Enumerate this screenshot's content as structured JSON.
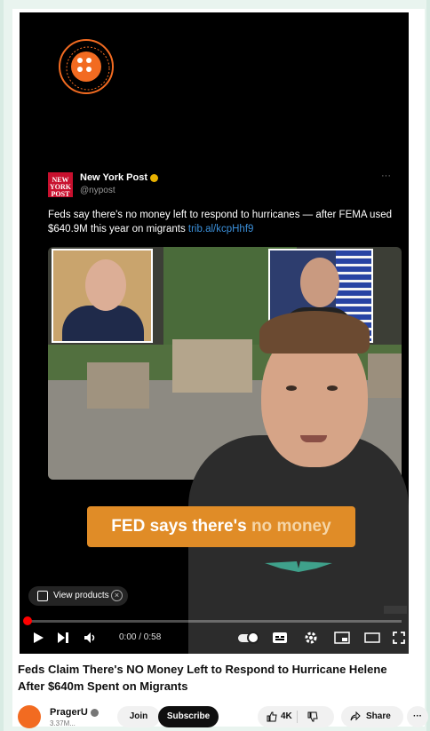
{
  "tweet": {
    "account_name": "New York Post",
    "handle": "@nypost",
    "logo_text": "NEW YORK POST",
    "more": "···",
    "text": "Feds say there's no money left to respond to hurricanes — after FEMA used $640.9M this year on migrants",
    "link": "trib.al/kcpHhf9"
  },
  "caption": {
    "part1": "FED says there's",
    "part2": "no money"
  },
  "overlay": {
    "view_products": "View products",
    "close": "×"
  },
  "player": {
    "time": "0:00 / 0:58",
    "progress": 0.0
  },
  "video": {
    "title": "Feds Claim There's NO Money Left to Respond to Hurricane Helene After $640m Spent on Migrants"
  },
  "channel": {
    "name": "PragerU",
    "subscribers": "3.37M...",
    "join_label": "Join",
    "subscribe_label": "Subscribe",
    "likes": "4K",
    "share_label": "Share",
    "more": "···"
  },
  "colors": {
    "accent": "#f26b21",
    "caption_bg": "#e08c27",
    "progress": "#ff0000"
  },
  "icons": [
    "play-icon",
    "next-icon",
    "volume-icon",
    "autoplay-toggle",
    "captions-icon",
    "settings-icon",
    "miniplayer-icon",
    "theater-icon",
    "fullscreen-icon",
    "like-icon",
    "dislike-icon",
    "share-icon"
  ]
}
